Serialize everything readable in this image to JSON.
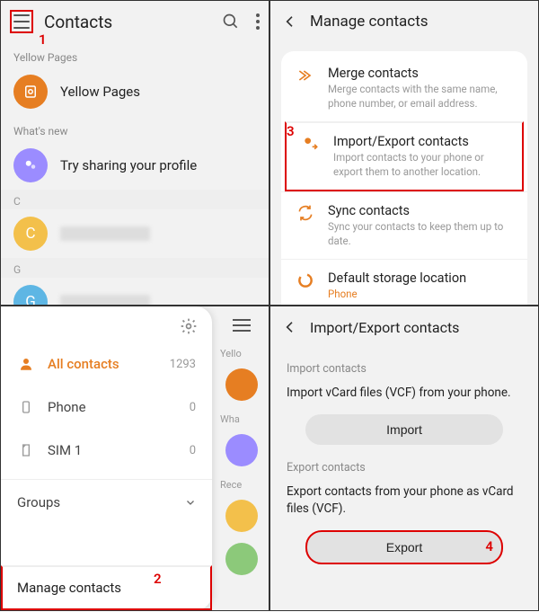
{
  "annotations": {
    "a1": "1",
    "a2": "2",
    "a3": "3",
    "a4": "4"
  },
  "p1": {
    "title": "Contacts",
    "sections": {
      "yellow_pages": {
        "label": "Yellow Pages",
        "item": "Yellow Pages"
      },
      "whats_new": {
        "label": "What's new",
        "item": "Try sharing your profile"
      },
      "c": {
        "letter": "C"
      },
      "g": {
        "letter": "G"
      }
    }
  },
  "p2": {
    "title": "Manage contacts",
    "items": [
      {
        "label": "Merge contacts",
        "desc": "Merge contacts with the same name, phone number, or email address."
      },
      {
        "label": "Import/Export contacts",
        "desc": "Import contacts to your phone or export them to another location."
      },
      {
        "label": "Sync contacts",
        "desc": "Sync your contacts to keep them up to date."
      },
      {
        "label": "Default storage location",
        "desc": "Phone"
      }
    ]
  },
  "p3": {
    "rows": [
      {
        "label": "All contacts",
        "count": "1293"
      },
      {
        "label": "Phone",
        "count": "0"
      },
      {
        "label": "SIM 1",
        "count": "0"
      }
    ],
    "groups_label": "Groups",
    "manage_label": "Manage contacts",
    "behind": {
      "yellow": "Yello",
      "what": "Wha",
      "rec": "Rece"
    }
  },
  "p4": {
    "title": "Import/Export contacts",
    "import_section": "Import contacts",
    "import_text": "Import vCard files (VCF) from your phone.",
    "import_btn": "Import",
    "export_section": "Export contacts",
    "export_text": "Export contacts from your phone as vCard files (VCF).",
    "export_btn": "Export"
  },
  "colors": {
    "orange": "#e67e22",
    "purple": "#9b8cff",
    "yellow": "#f3c04b",
    "blue": "#5eb6e4",
    "green": "#8cc97a",
    "red_annot": "#d00"
  }
}
